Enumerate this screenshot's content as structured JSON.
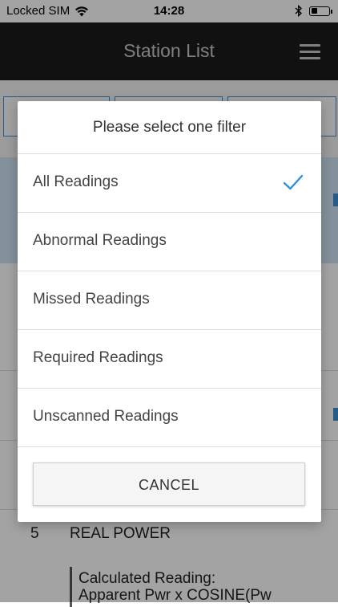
{
  "status_bar": {
    "carrier": "Locked SIM",
    "time": "14:28",
    "battery_level": 0.35,
    "icons": [
      "wifi-icon",
      "bluetooth-icon",
      "battery-icon"
    ]
  },
  "header": {
    "title": "Station List",
    "menu_icon": "hamburger-menu-icon",
    "background_color": "#1c1c1c"
  },
  "background_item": {
    "number": "5",
    "name": "REAL POWER",
    "calculated_line1": "Calculated Reading:",
    "calculated_line2": "Apparent Pwr x COSINE(Pw"
  },
  "dialog": {
    "title": "Please select one filter",
    "options": [
      {
        "label": "All Readings",
        "selected": true
      },
      {
        "label": "Abnormal Readings",
        "selected": false
      },
      {
        "label": "Missed Readings",
        "selected": false
      },
      {
        "label": "Required Readings",
        "selected": false
      },
      {
        "label": "Unscanned Readings",
        "selected": false
      }
    ],
    "cancel_label": "CANCEL",
    "accent_color": "#2f8fd8"
  }
}
